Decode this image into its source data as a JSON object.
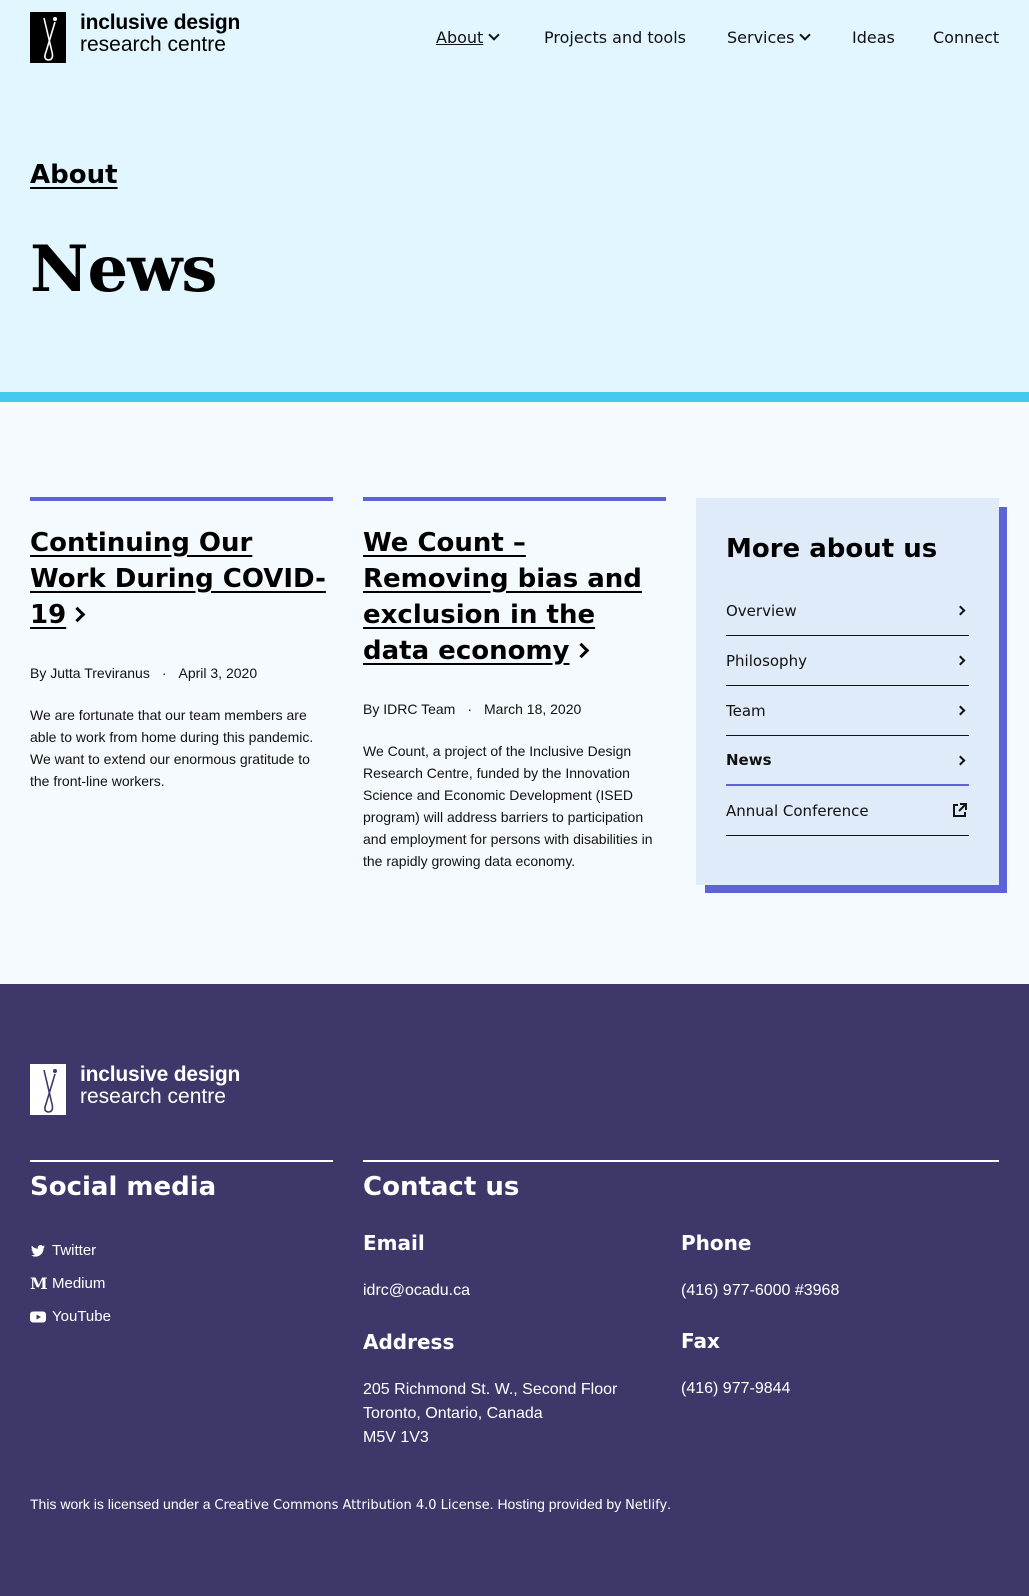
{
  "logo": {
    "line1": "inclusive design",
    "line2": "research centre"
  },
  "nav": [
    {
      "label": "About",
      "dropdown": true,
      "current": true
    },
    {
      "label": "Projects and tools",
      "dropdown": false
    },
    {
      "label": "Services",
      "dropdown": true
    },
    {
      "label": "Ideas",
      "dropdown": false
    },
    {
      "label": "Connect",
      "dropdown": false
    }
  ],
  "breadcrumb": "About",
  "page_title": "News",
  "posts": [
    {
      "title": "Continuing Our Work During COVID-19",
      "author": "By Jutta Treviranus",
      "separator": "·",
      "date": "April 3, 2020",
      "excerpt": "We are fortunate that our team members are able to work from home during this pandemic. We want to extend our enormous gratitude to the front-line workers."
    },
    {
      "title": "We Count – Removing bias and exclusion in the data economy",
      "author": "By IDRC Team",
      "separator": "·",
      "date": "March 18, 2020",
      "excerpt": "We Count, a project of the Inclusive Design Research Centre, funded by the Innovation Science and Economic Development (ISED program) will address barriers to participation and employment for persons with disabilities in the rapidly growing data economy."
    }
  ],
  "sidebar": {
    "title": "More about us",
    "links": [
      {
        "label": "Overview",
        "icon": "chevron-right-icon"
      },
      {
        "label": "Philosophy",
        "icon": "chevron-right-icon"
      },
      {
        "label": "Team",
        "icon": "chevron-right-icon"
      },
      {
        "label": "News",
        "icon": "chevron-right-icon",
        "active": true
      },
      {
        "label": "Annual Conference",
        "icon": "external-link-icon"
      }
    ]
  },
  "footer": {
    "social_title": "Social media",
    "social": [
      {
        "label": "Twitter",
        "icon": "twitter-icon"
      },
      {
        "label": "Medium",
        "icon": "medium-icon"
      },
      {
        "label": "YouTube",
        "icon": "youtube-icon"
      }
    ],
    "contact_title": "Contact us",
    "email_label": "Email",
    "email": "idrc@ocadu.ca",
    "phone_label": "Phone",
    "phone": "(416) 977-6000 #3968",
    "address_label": "Address",
    "address_lines": [
      "205 Richmond St. W., Second Floor",
      "Toronto, Ontario, Canada",
      "M5V 1V3"
    ],
    "fax_label": "Fax",
    "fax": "(416) 977-9844",
    "license_prefix": "This work is licensed under a ",
    "license_link": "Creative Commons Attribution 4.0 License",
    "license_mid": ". Hosting provided by ",
    "host_link": "Netlify",
    "license_suffix": "."
  },
  "colors": {
    "hero_bg": "#e1f6fe",
    "accent_stripe": "#45c8f0",
    "purple_accent": "#5d63d7",
    "footer_bg": "#3e376a",
    "sidebar_bg": "#dfebf9"
  }
}
